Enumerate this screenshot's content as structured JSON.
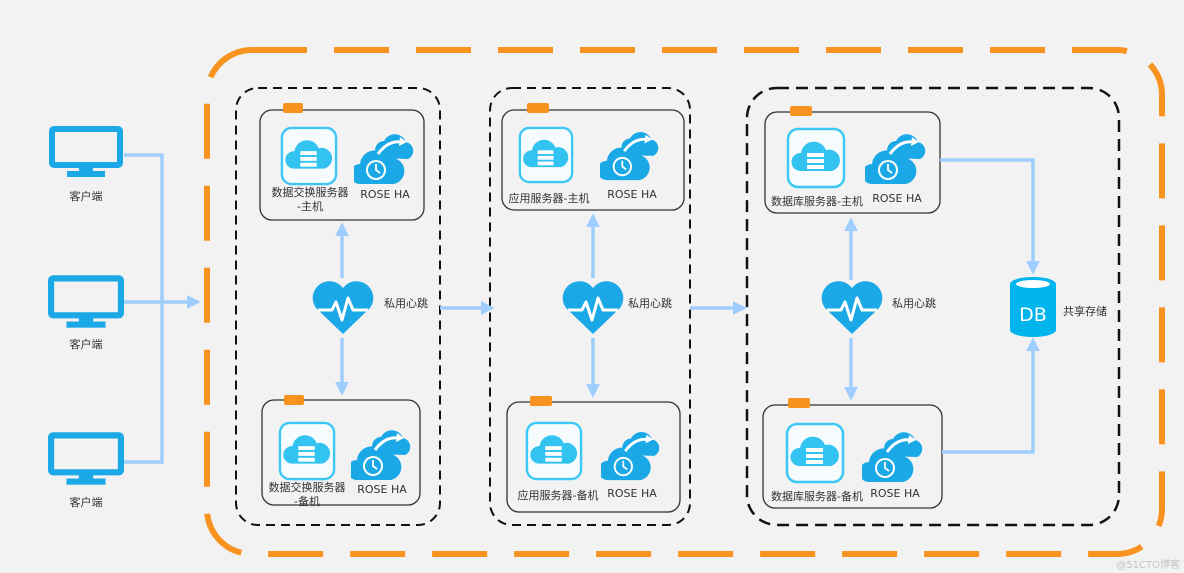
{
  "colors": {
    "orange": "#f7931e",
    "blue": "#1aa8e6",
    "light_blue_line": "#9fcdfd",
    "black_dash": "#111111",
    "background": "#f2f2f2"
  },
  "icons": {
    "client": "monitor-icon",
    "server": "cloud-server-icon",
    "ha": "cloud-clock-icon",
    "heartbeat": "heartbeat-icon",
    "storage": "database-icon"
  },
  "clients": [
    {
      "label": "客户端"
    },
    {
      "label": "客户端"
    },
    {
      "label": "客户端"
    }
  ],
  "groups": [
    {
      "primary": {
        "server_line1": "数据交换服务器",
        "server_line2": "-主机",
        "ha": "ROSE HA"
      },
      "standby": {
        "server_line1": "数据交换服务器",
        "server_line2": "-备机",
        "ha": "ROSE HA"
      },
      "heartbeat": "私用心跳"
    },
    {
      "primary": {
        "server_line1": "应用服务器-主机",
        "ha": "ROSE HA"
      },
      "standby": {
        "server_line1": "应用服务器-备机",
        "ha": "ROSE HA"
      },
      "heartbeat": "私用心跳"
    },
    {
      "primary": {
        "server_line1": "数据库服务器-主机",
        "ha": "ROSE HA"
      },
      "standby": {
        "server_line1": "数据库服务器-备机",
        "ha": "ROSE HA"
      },
      "heartbeat": "私用心跳"
    }
  ],
  "storage": {
    "db_text": "DB",
    "label": "共享存储"
  },
  "watermark": "@51CTO博客"
}
